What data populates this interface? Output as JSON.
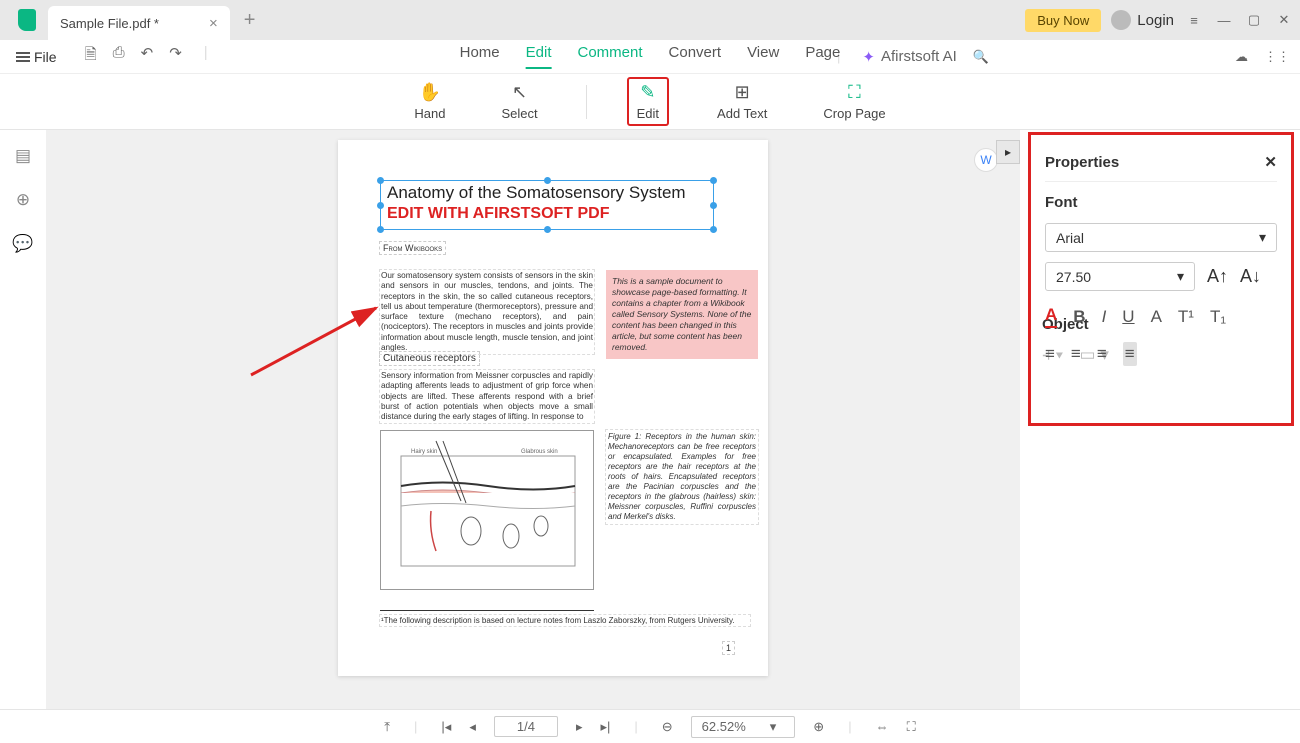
{
  "titlebar": {
    "tab_title": "Sample File.pdf *",
    "buy_now": "Buy Now",
    "login": "Login"
  },
  "menubar": {
    "file": "File",
    "items": [
      "Home",
      "Edit",
      "Comment",
      "Convert",
      "View",
      "Page"
    ],
    "ai": "Afirstsoft AI"
  },
  "toolbar": {
    "hand": "Hand",
    "select": "Select",
    "edit": "Edit",
    "add_text": "Add Text",
    "crop": "Crop Page"
  },
  "document": {
    "title": "Anatomy of the Somatosensory System",
    "edited": "EDIT WITH AFIRSTSOFT PDF",
    "wiki": "From Wikibooks",
    "para1": "Our somatosensory system consists of sensors in the skin and sensors in our muscles, tendons, and joints. The receptors in the skin, the so called cutaneous receptors, tell us about temperature (thermoreceptors), pressure and surface texture (mechano receptors), and pain (nociceptors). The receptors in muscles and joints provide information about muscle length, muscle tension, and joint angles.",
    "note": "This is a sample document to showcase page-based formatting. It contains a chapter from a Wikibook called Sensory Systems. None of the content has been changed in this article, but some content has been removed.",
    "sub": "Cutaneous receptors",
    "para2": "Sensory information from Meissner corpuscles and rapidly adapting afferents leads to adjustment of grip force when objects are lifted. These afferents respond with a brief burst of action potentials when objects move a small distance during the early stages of lifting. In response to",
    "fig": "Figure 1: Receptors in the human skin: Mechanoreceptors can be free receptors or encapsulated. Examples for free receptors are the hair receptors at the roots of hairs. Encapsulated receptors are the Pacinian corpuscles and the receptors in the glabrous (hairless) skin: Meissner corpuscles, Ruffini corpuscles and Merkel's disks.",
    "footnote": "¹The following description is based on lecture notes from Laszlo Zaborszky, from Rutgers University.",
    "page_num": "1"
  },
  "panel": {
    "title": "Properties",
    "font_section": "Font",
    "font_family": "Arial",
    "font_size": "27.50",
    "object_section": "Object"
  },
  "status": {
    "page": "1/4",
    "zoom": "62.52%"
  }
}
